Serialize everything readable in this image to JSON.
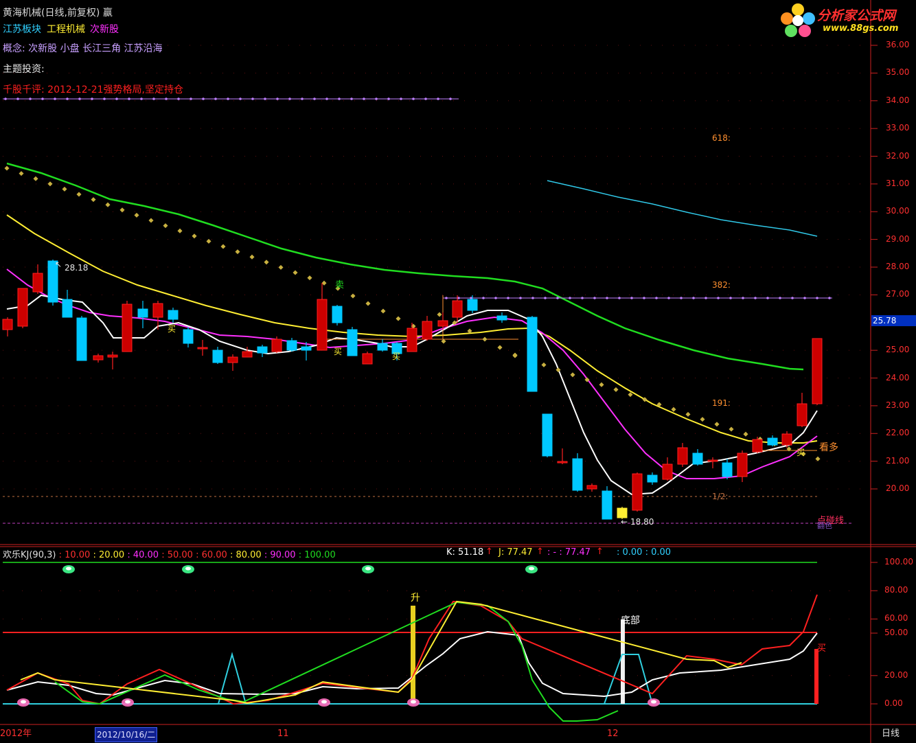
{
  "header": {
    "title": "黄海机械(日线,前复权) 赢",
    "sector1": "江苏板块",
    "sector2": "工程机械",
    "sector3": "次新股",
    "concept": "概念: 次新股 小盘 长江三角 江苏沿海",
    "theme": "主题投资:",
    "comment": "千股千评: 2012-12-21强势格局,坚定持仓"
  },
  "logo": {
    "name": "分析家公式网",
    "url": "www.88gs.com"
  },
  "colors": {
    "up": "#ff2020",
    "down": "#00c8ff",
    "ma_white": "#ffffff",
    "ma_yellow": "#ffee33",
    "ma_magenta": "#ff30ff",
    "ma_green": "#20dd20",
    "ma_cyan": "#30c8e8",
    "sar": "#c8b040",
    "fib": "#c080ff",
    "axis": "#cc2020"
  },
  "price_axis": {
    "ticks": [
      "36.00",
      "35.00",
      "34.00",
      "33.00",
      "32.00",
      "31.00",
      "30.00",
      "29.00",
      "28.00",
      "27.00",
      "25.00",
      "24.00",
      "23.00",
      "22.00",
      "21.00",
      "20.00"
    ],
    "current": "25.78"
  },
  "annotations": {
    "high": "28.18",
    "low": "18.80",
    "sell": "卖",
    "buy": "买",
    "fib618": "618:",
    "fib382": "382:",
    "fib191": "191:",
    "half": "1/2:",
    "bullish": "看多",
    "risk_line": "点碰线",
    "risk_sub": "翻色"
  },
  "indicator": {
    "name": "欢乐KJ(90,3)",
    "levels": [
      ": 10.00",
      ": 20.00",
      ": 40.00",
      ": 50.00",
      ": 60.00",
      ": 80.00",
      ": 90.00",
      ": 100.00"
    ],
    "k_label": "K: 51.18",
    "j_label": "J: 77.47",
    "dash_label": ": - : 77.47",
    "zero_labels": ": 0.00 : 0.00",
    "ticks": [
      "100.00",
      "80.00",
      "60.00",
      "50.00",
      "20.00",
      "0.00"
    ],
    "rise": "升",
    "bottom": "底部",
    "buy": "买"
  },
  "date_axis": {
    "year": "2012年",
    "cursor": "2012/10/16/二",
    "m11": "11",
    "m12": "12",
    "period": "日线"
  },
  "chart_data": {
    "type": "candlestick",
    "ylim": [
      19.0,
      36.4
    ],
    "candles": [
      {
        "o": 20.96,
        "c": 20.96,
        "h": 21.13,
        "l": 20.75
      },
      {
        "o": 21.37,
        "c": 21.75,
        "h": 21.85,
        "l": 21.3
      },
      {
        "o": 21.6,
        "c": 21.98,
        "h": 22.38,
        "l": 21.5
      },
      {
        "o": 21.3,
        "c": 21.12,
        "h": 21.78,
        "l": 21.06
      },
      {
        "o": 20.6,
        "c": 20.6,
        "h": 20.72,
        "l": 20.48
      },
      {
        "o": 20.12,
        "c": 20.05,
        "h": 20.18,
        "l": 19.94
      },
      {
        "o": 19.82,
        "c": 19.48,
        "h": 19.82,
        "l": 19.3
      },
      {
        "o": 19.25,
        "c": 19.62,
        "h": 19.68,
        "l": 19.25
      },
      {
        "o": 19.58,
        "c": 20.3,
        "h": 20.52,
        "l": 19.48
      },
      {
        "o": 20.5,
        "c": 20.9,
        "h": 21.0,
        "l": 20.4
      },
      {
        "o": 20.75,
        "c": 21.15,
        "h": 21.2,
        "l": 20.6
      },
      {
        "o": 21.05,
        "c": 21.05,
        "h": 21.5,
        "l": 20.55
      },
      {
        "o": 21.08,
        "c": 20.9,
        "h": 21.25,
        "l": 20.8
      },
      {
        "o": 21.3,
        "c": 21.45,
        "h": 21.55,
        "l": 21.25
      },
      {
        "o": 21.5,
        "c": 21.85,
        "h": 21.88,
        "l": 21.3
      },
      {
        "o": 22.05,
        "c": 22.85,
        "h": 23.35,
        "l": 22.0
      },
      {
        "o": 23.05,
        "c": 25.78,
        "h": 25.78,
        "l": 23.05
      }
    ],
    "sar": [
      31.6,
      31.4,
      31.2,
      31.0,
      30.8,
      30.6,
      30.4,
      30.2,
      30.0,
      29.8,
      29.6,
      29.4,
      29.2,
      29.0,
      28.8,
      28.6,
      28.4,
      28.2,
      28.0,
      27.8,
      27.4,
      27.0,
      26.8,
      26.6,
      26.4,
      26.2,
      26.0,
      25.8,
      25.6,
      25.4,
      25.2,
      25.0,
      24.8,
      24.6,
      24.4,
      24.2,
      24.0,
      23.8,
      23.6,
      23.4,
      23.2,
      23.0,
      22.8,
      22.6,
      22.4,
      22.2,
      22.0,
      21.8,
      21.6,
      21.4,
      21.2,
      21.0,
      20.8,
      20.6,
      20.4,
      20.2,
      20.0,
      19.8,
      19.6,
      19.4,
      19.2,
      19.0,
      18.8
    ],
    "note": "Daily price chart with moving averages and KJ oscillator"
  }
}
